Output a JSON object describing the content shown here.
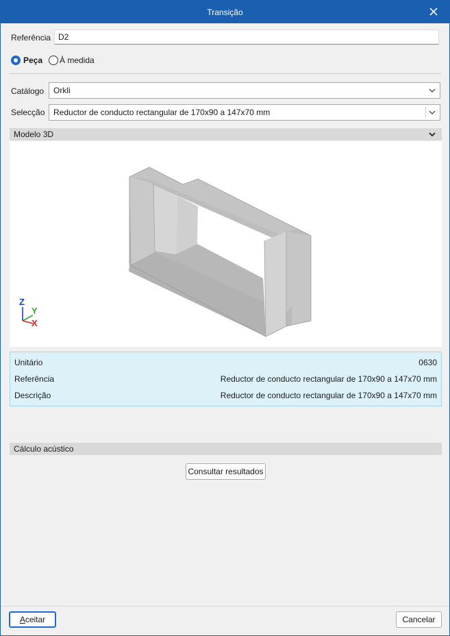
{
  "window": {
    "title": "Transição"
  },
  "referencia": {
    "label": "Referência",
    "value": "D2"
  },
  "mode": {
    "option1": "Peça",
    "option2": "À medida",
    "selected": "Peça"
  },
  "catalogo": {
    "label": "Catálogo",
    "value": "Orkli"
  },
  "seleccao": {
    "label": "Selecção",
    "value": "Reductor de conducto rectangular de 170x90 a 147x70 mm"
  },
  "model3d": {
    "header": "Modelo 3D",
    "axes": {
      "z": "Z",
      "y": "Y",
      "x": "X"
    },
    "colors": {
      "z": "#1a3ccf",
      "y": "#2fa82f",
      "x": "#e02020"
    }
  },
  "info": {
    "rows": [
      {
        "key": "Unitário",
        "value": "0630"
      },
      {
        "key": "Referência",
        "value": "Reductor de conducto rectangular de 170x90 a 147x70 mm"
      },
      {
        "key": "Descrição",
        "value": "Reductor de conducto rectangular de 170x90 a 147x70 mm"
      }
    ]
  },
  "acoustic": {
    "header": "Cálculo acústico",
    "button": "Consultar resultados"
  },
  "footer": {
    "accept_first": "A",
    "accept_rest": "ceitar",
    "cancel": "Cancelar"
  },
  "colors": {
    "titlebar": "#1b5fb0",
    "accent": "#1b6ac9",
    "info_bg": "#dcf2f8"
  }
}
